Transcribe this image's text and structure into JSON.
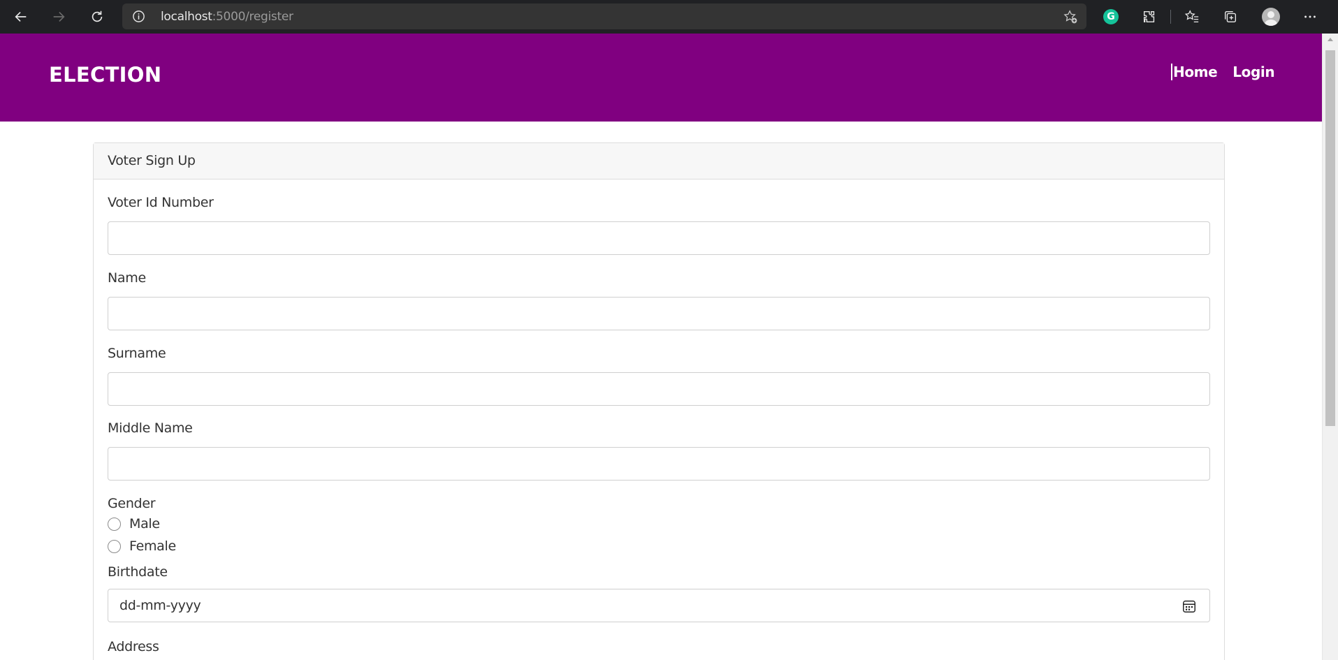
{
  "browser": {
    "url_host": "localhost",
    "url_path": ":5000/register",
    "icons": [
      "back-arrow-icon",
      "forward-arrow-icon",
      "reload-icon",
      "info-icon",
      "add-favorite-icon",
      "grammarly-icon",
      "extensions-icon",
      "favorites-icon",
      "collections-icon",
      "profile-avatar",
      "more-menu-icon"
    ],
    "grammarly_letter": "G"
  },
  "navbar": {
    "brand": "ELECTION",
    "links": [
      {
        "label": "Home"
      },
      {
        "label": "Login"
      }
    ],
    "color": "#800080"
  },
  "form": {
    "title": "Voter Sign Up",
    "fields": {
      "voter_id": {
        "label": "Voter Id Number",
        "value": ""
      },
      "name": {
        "label": "Name",
        "value": ""
      },
      "surname": {
        "label": "Surname",
        "value": ""
      },
      "middle_name": {
        "label": "Middle Name",
        "value": ""
      },
      "gender": {
        "label": "Gender",
        "options": [
          {
            "label": "Male",
            "selected": false
          },
          {
            "label": "Female",
            "selected": false
          }
        ]
      },
      "birthdate": {
        "label": "Birthdate",
        "placeholder": "dd-mm-yyyy"
      },
      "address": {
        "label": "Address"
      }
    }
  }
}
